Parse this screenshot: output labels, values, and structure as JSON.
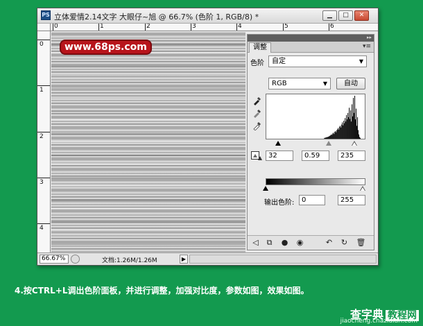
{
  "window": {
    "app_icon": "PS",
    "title": "立体爱情2.14文字    大眼仔~旭 @ 66.7% (色阶 1, RGB/8) *",
    "min_symbol": "▁",
    "max_symbol": "□",
    "close_symbol": "✕"
  },
  "ruler": {
    "h_labels": [
      "0",
      "1",
      "2",
      "3",
      "4",
      "5",
      "6"
    ],
    "v_labels": [
      "0",
      "1",
      "2",
      "3",
      "4"
    ]
  },
  "canvas": {
    "watermark": "www.68ps.com"
  },
  "statusbar": {
    "zoom": "66.67%",
    "doc_info": "文档:1.26M/1.26M",
    "arrow": "▶"
  },
  "panel": {
    "tab": "调整",
    "menu_symbol": "▾≡",
    "preset_label": "色阶",
    "preset_value": "自定",
    "channel_value": "RGB",
    "auto_button": "自动",
    "input_black": "32",
    "input_gamma": "0.59",
    "input_white": "235",
    "output_label": "输出色阶:",
    "output_black": "0",
    "output_white": "255",
    "histogram_levels": [
      0,
      0,
      0,
      0,
      0,
      0,
      0,
      0,
      0,
      0,
      0,
      0,
      0,
      0,
      0,
      0,
      0,
      0,
      0,
      0,
      0,
      0,
      0,
      0,
      0,
      0,
      0,
      0,
      0,
      0,
      0,
      0,
      0,
      0,
      0,
      0,
      0,
      0,
      0,
      0,
      0,
      0,
      0,
      0,
      0,
      0,
      0,
      0,
      0,
      0,
      0,
      0,
      0,
      0,
      0,
      0,
      0,
      0,
      0,
      0,
      0,
      0,
      0,
      0,
      0,
      0,
      0,
      0,
      0,
      0,
      0,
      0,
      0,
      0,
      0,
      0,
      0,
      0,
      0,
      0,
      0,
      0,
      0,
      0,
      0.02,
      0.02,
      0.03,
      0.03,
      0.04,
      0.04,
      0.05,
      0.06,
      0.07,
      0.08,
      0.1,
      0.09,
      0.12,
      0.14,
      0.11,
      0.16,
      0.18,
      0.15,
      0.2,
      0.22,
      0.25,
      0.21,
      0.28,
      0.3,
      0.26,
      0.33,
      0.38,
      0.31,
      0.42,
      0.36,
      0.48,
      0.4,
      0.55,
      0.45,
      0.6,
      0.5,
      0.72,
      0.46,
      0.66,
      0.4,
      0.8,
      0.52,
      0.95,
      0.6,
      1.0,
      0.45,
      0.7,
      0.3,
      0.5,
      0.2,
      0.1,
      0.04,
      0.02,
      0,
      0,
      0,
      0,
      0,
      0
    ]
  },
  "caption": "4.按CTRL+L调出色阶面板，并进行调整，加强对比度，参数如图，效果如图。",
  "footer": {
    "brand": "查字典",
    "brand_box": "教程网",
    "url": "jiaocheng.chazidian.com"
  }
}
